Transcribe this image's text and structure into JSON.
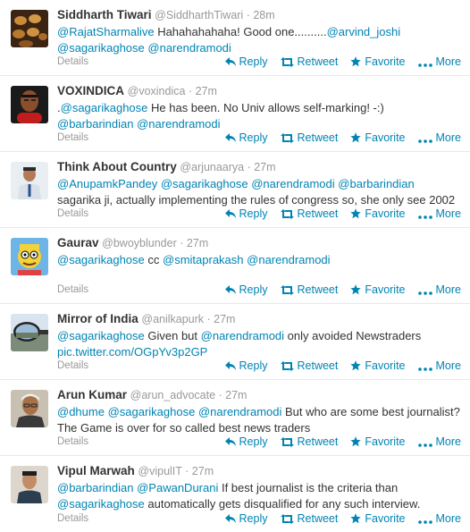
{
  "details_label": "Details",
  "actions": {
    "reply": "Reply",
    "retweet": "Retweet",
    "favorite": "Favorite",
    "more": "More"
  },
  "colors": {
    "link": "#0084b4",
    "meta": "#999999",
    "text": "#333333"
  },
  "tweets": [
    {
      "name": "Siddharth Tiwari",
      "handle": "@SiddharthTiwari",
      "time": "28m",
      "segments": [
        {
          "t": "mention",
          "v": "@RajatSharmalive"
        },
        {
          "t": "text",
          "v": " Hahahahahaha! Good one.........."
        },
        {
          "t": "mention",
          "v": "@arvind_joshi"
        },
        {
          "t": "text",
          "v": " "
        },
        {
          "t": "mention",
          "v": "@sagarikaghose"
        },
        {
          "t": "text",
          "v": " "
        },
        {
          "t": "mention",
          "v": "@narendramodi"
        }
      ]
    },
    {
      "name": "VOXINDICA",
      "handle": "@voxindica",
      "time": "27m",
      "segments": [
        {
          "t": "text",
          "v": "."
        },
        {
          "t": "mention",
          "v": "@sagarikaghose"
        },
        {
          "t": "text",
          "v": " He has been. No Univ allows self-marking! -:) "
        },
        {
          "t": "mention",
          "v": "@barbarindian"
        },
        {
          "t": "text",
          "v": " "
        },
        {
          "t": "mention",
          "v": "@narendramodi"
        }
      ]
    },
    {
      "name": "Think About Country",
      "handle": "@arjunaarya",
      "time": "27m",
      "segments": [
        {
          "t": "mention",
          "v": "@AnupamkPandey"
        },
        {
          "t": "text",
          "v": " "
        },
        {
          "t": "mention",
          "v": "@sagarikaghose"
        },
        {
          "t": "text",
          "v": " "
        },
        {
          "t": "mention",
          "v": "@narendramodi"
        },
        {
          "t": "text",
          "v": " "
        },
        {
          "t": "mention",
          "v": "@barbarindian"
        },
        {
          "t": "text",
          "v": " sagarika ji, actually implementing the rules of congress so, she only see 2002"
        }
      ]
    },
    {
      "name": "Gaurav",
      "handle": "@bwoyblunder",
      "time": "27m",
      "segments": [
        {
          "t": "mention",
          "v": "@sagarikaghose"
        },
        {
          "t": "text",
          "v": " cc "
        },
        {
          "t": "mention",
          "v": "@smitaprakash"
        },
        {
          "t": "text",
          "v": " "
        },
        {
          "t": "mention",
          "v": "@narendramodi"
        }
      ]
    },
    {
      "name": "Mirror of India",
      "handle": "@anilkapurk",
      "time": "27m",
      "segments": [
        {
          "t": "mention",
          "v": "@sagarikaghose"
        },
        {
          "t": "text",
          "v": " Given but "
        },
        {
          "t": "mention",
          "v": "@narendramodi"
        },
        {
          "t": "text",
          "v": " only avoided Newstraders "
        },
        {
          "t": "link",
          "v": "pic.twitter.com/OGpYv3p2GP"
        }
      ]
    },
    {
      "name": "Arun Kumar",
      "handle": "@arun_advocate",
      "time": "27m",
      "segments": [
        {
          "t": "mention",
          "v": "@dhume"
        },
        {
          "t": "text",
          "v": " "
        },
        {
          "t": "mention",
          "v": "@sagarikaghose"
        },
        {
          "t": "text",
          "v": " "
        },
        {
          "t": "mention",
          "v": "@narendramodi"
        },
        {
          "t": "text",
          "v": " But who are  some best journalist? The Game is over for so called best news traders"
        }
      ]
    },
    {
      "name": "Vipul Marwah",
      "handle": "@vipulIT",
      "time": "27m",
      "segments": [
        {
          "t": "mention",
          "v": "@barbarindian"
        },
        {
          "t": "text",
          "v": " "
        },
        {
          "t": "mention",
          "v": "@PawanDurani"
        },
        {
          "t": "text",
          "v": " If best journalist is the criteria than "
        },
        {
          "t": "mention",
          "v": "@sagarikaghose"
        },
        {
          "t": "text",
          "v": " automatically gets disqualified for any such interview."
        }
      ]
    }
  ]
}
